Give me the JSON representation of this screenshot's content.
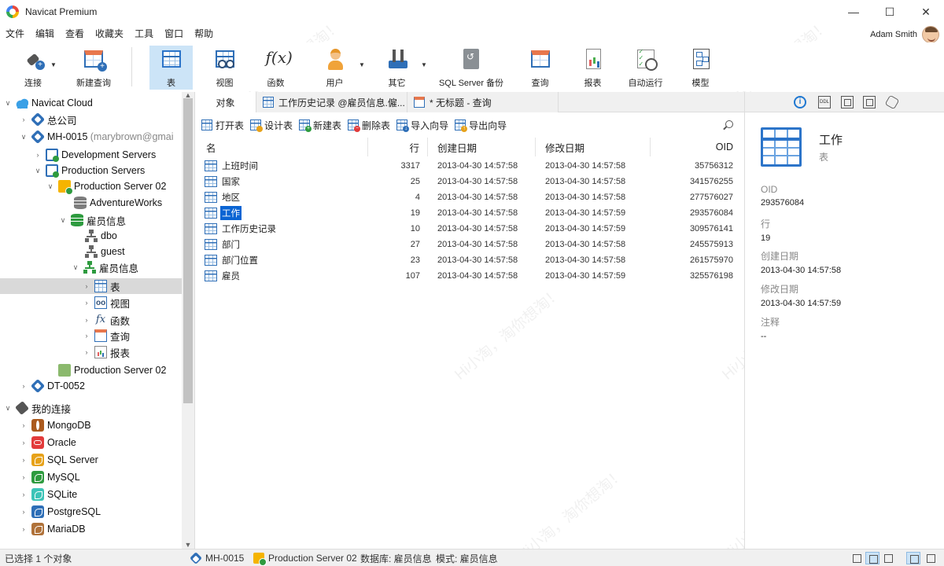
{
  "window": {
    "title": "Navicat Premium",
    "controls": {
      "minimize": "—",
      "maximize": "☐",
      "close": "✕"
    }
  },
  "menu": [
    "文件",
    "编辑",
    "查看",
    "收藏夹",
    "工具",
    "窗口",
    "帮助"
  ],
  "user": {
    "name": "Adam Smith"
  },
  "toolbar": {
    "connect": "连接",
    "new_query": "新建查询",
    "table": "表",
    "view": "视图",
    "function": "函数",
    "user": "用户",
    "other": "其它",
    "sqlserver_backup": "SQL Server 备份",
    "query": "查询",
    "report": "报表",
    "automation": "自动运行",
    "model": "模型"
  },
  "nav": {
    "cloud": "Navicat Cloud",
    "head_office": "总公司",
    "project": "MH-0015",
    "project_owner": "(marybrown@gmai",
    "dev_servers": "Development Servers",
    "prod_servers": "Production Servers",
    "prod_server_02": "Production Server 02",
    "adventureworks": "AdventureWorks",
    "employee_db": "雇员信息",
    "dbo": "dbo",
    "guest": "guest",
    "employee_schema": "雇员信息",
    "tables": "表",
    "views": "视图",
    "functions": "函数",
    "queries": "查询",
    "reports": "报表",
    "prod_server_02_b": "Production Server 02",
    "dt_0052": "DT-0052",
    "my_connections": "我的连接",
    "mongodb": "MongoDB",
    "oracle": "Oracle",
    "sqlserver": "SQL Server",
    "mysql": "MySQL",
    "sqlite": "SQLite",
    "postgresql": "PostgreSQL",
    "mariadb": "MariaDB"
  },
  "tabs": {
    "objects": "对象",
    "tab1": "工作历史记录 @雇员信息.僱...",
    "tab2": "* 无标题 - 查询"
  },
  "object_toolbar": {
    "open_table": "打开表",
    "design_table": "设计表",
    "new_table": "新建表",
    "delete_table": "删除表",
    "import_wizard": "导入向导",
    "export_wizard": "导出向导"
  },
  "grid": {
    "headers": {
      "name": "名",
      "rows": "行",
      "created": "创建日期",
      "modified": "修改日期",
      "oid": "OID"
    },
    "rows": [
      {
        "name": "上班时间",
        "rows": "3317",
        "created": "2013-04-30 14:57:58",
        "modified": "2013-04-30 14:57:58",
        "oid": "35756312"
      },
      {
        "name": "国家",
        "rows": "25",
        "created": "2013-04-30 14:57:58",
        "modified": "2013-04-30 14:57:58",
        "oid": "341576255"
      },
      {
        "name": "地区",
        "rows": "4",
        "created": "2013-04-30 14:57:58",
        "modified": "2013-04-30 14:57:58",
        "oid": "277576027"
      },
      {
        "name": "工作",
        "rows": "19",
        "created": "2013-04-30 14:57:58",
        "modified": "2013-04-30 14:57:59",
        "oid": "293576084",
        "selected": true
      },
      {
        "name": "工作历史记录",
        "rows": "10",
        "created": "2013-04-30 14:57:58",
        "modified": "2013-04-30 14:57:59",
        "oid": "309576141"
      },
      {
        "name": "部门",
        "rows": "27",
        "created": "2013-04-30 14:57:58",
        "modified": "2013-04-30 14:57:58",
        "oid": "245575913"
      },
      {
        "name": "部门位置",
        "rows": "23",
        "created": "2013-04-30 14:57:58",
        "modified": "2013-04-30 14:57:58",
        "oid": "261575970"
      },
      {
        "name": "雇员",
        "rows": "107",
        "created": "2013-04-30 14:57:58",
        "modified": "2013-04-30 14:57:59",
        "oid": "325576198"
      }
    ]
  },
  "info": {
    "title": "工作",
    "subtitle": "表",
    "icon_info_glyph": "i",
    "icon_ddl_glyph": "DDL",
    "fields": {
      "oid_label": "OID",
      "oid_value": "293576084",
      "rows_label": "行",
      "rows_value": "19",
      "created_label": "创建日期",
      "created_value": "2013-04-30 14:57:58",
      "modified_label": "修改日期",
      "modified_value": "2013-04-30 14:57:59",
      "comment_label": "注释",
      "comment_value": "--"
    }
  },
  "status": {
    "selection": "已选择 1 个对象",
    "connection": "MH-0015",
    "server": "Production Server 02",
    "database": "数据库: 雇员信息",
    "schema": "模式: 雇员信息"
  },
  "watermark": "Hi小淘，淘你想淘！",
  "colors": {
    "accent": "#2f6fb7",
    "selection": "#0a64d3",
    "active_tool": "#cce4f7"
  }
}
